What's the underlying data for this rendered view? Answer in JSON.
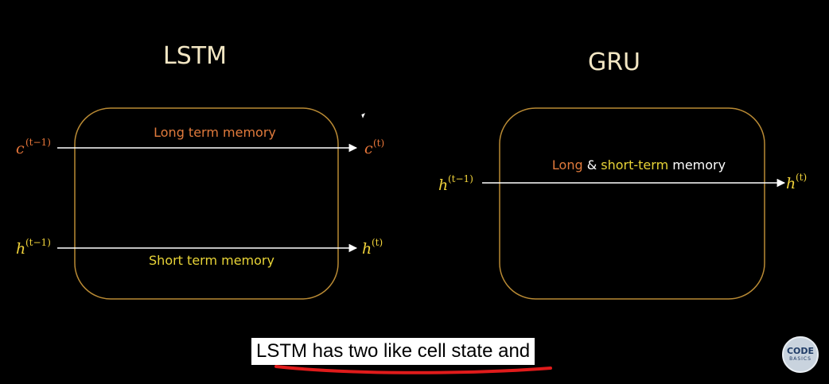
{
  "lstm": {
    "title": "LSTM",
    "long_label": "Long term memory",
    "short_label": "Short term memory",
    "inputs": [
      {
        "var": "c",
        "sup": "(t−1)"
      },
      {
        "var": "h",
        "sup": "(t−1)"
      }
    ],
    "outputs": [
      {
        "var": "c",
        "sup": "(t)"
      },
      {
        "var": "h",
        "sup": "(t)"
      }
    ]
  },
  "gru": {
    "title": "GRU",
    "memory_label_parts": [
      "Long",
      " & ",
      "short-term",
      " memory"
    ],
    "input": {
      "var": "h",
      "sup": "(t−1)"
    },
    "output": {
      "var": "h",
      "sup": "(t)"
    }
  },
  "caption": {
    "text": "LSTM has two like cell state and"
  },
  "logo": {
    "top": "CODE",
    "bottom": "BASICS"
  },
  "colors": {
    "box_border": "#b98a34",
    "long_memory": "#e07a3c",
    "short_memory": "#e8d437",
    "hidden_var": "#f0d23a",
    "cell_var": "#e8763a",
    "arrow": "#ffffff",
    "underline": "#e01b1b"
  }
}
